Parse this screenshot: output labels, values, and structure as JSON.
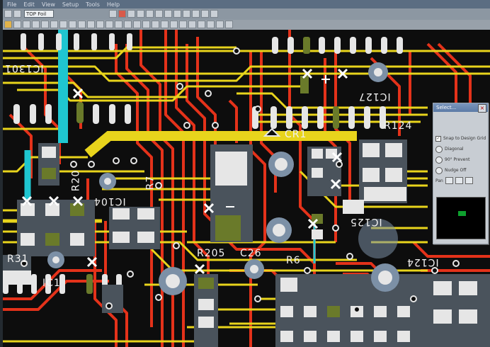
{
  "menu": {
    "items": [
      "File",
      "Edit",
      "View",
      "Setup",
      "Tools",
      "Help"
    ]
  },
  "toolbar": {
    "layer_value": "TOP Foil"
  },
  "palette": {
    "title": "Select...",
    "close_label": "×",
    "options": [
      {
        "label": "Snap to Design Grid",
        "checked": true
      },
      {
        "label": "Diagonal"
      },
      {
        "label": "90° Prevent"
      },
      {
        "label": "Nudge Off"
      }
    ],
    "zoom_label": "Pan"
  },
  "silkscreen": {
    "labels": [
      "IC1301",
      "R124",
      "CR1",
      "IC124",
      "IC125",
      "IC104",
      "IC127",
      "R20",
      "R6",
      "R205",
      "C26",
      "R31",
      "R7",
      "IC1"
    ]
  },
  "colors": {
    "board": "#0d0d0d",
    "copper_top": "#e8d41c",
    "copper_bottom": "#e4321a",
    "pad": "#e6e6e6",
    "via_ring": "#7c90a6",
    "highlight": "#1fc6d0",
    "selected_pad": "#6a7a2a"
  }
}
